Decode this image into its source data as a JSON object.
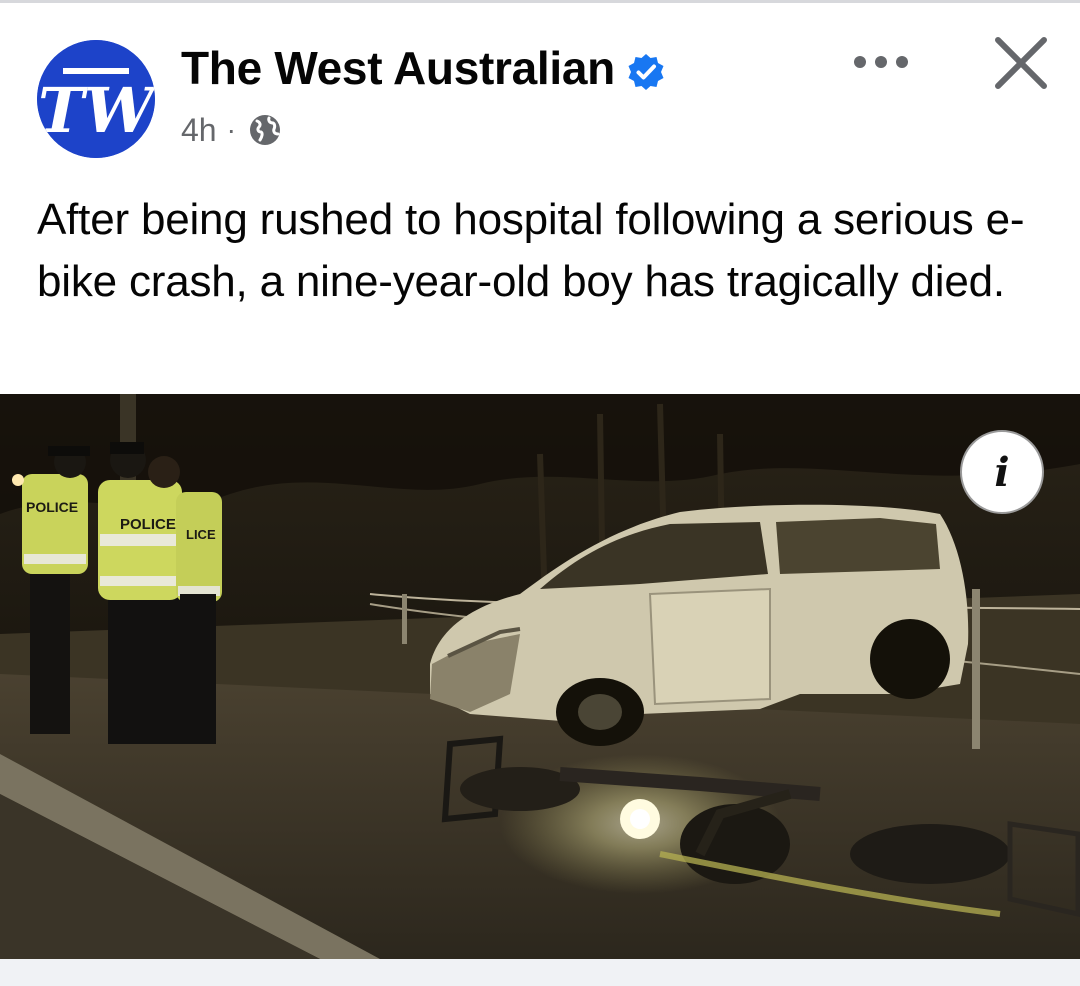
{
  "post": {
    "page_name": "The West Australian",
    "avatar_monogram": "TW",
    "timestamp": "4h",
    "separator": "·",
    "audience_icon": "globe-icon",
    "verified_icon": "verified-badge-icon",
    "caption": "After being rushed to hospital following a serious e-bike crash, a nine-year-old boy has tragically died.",
    "menu_icon": "more-options-icon",
    "close_icon": "close-icon"
  },
  "photo": {
    "vest_labels": [
      "POLICE",
      "POLICE",
      "LICE"
    ],
    "info_label": "i"
  },
  "colors": {
    "brand_blue": "#1d43c9",
    "verified_blue": "#1877f2",
    "secondary_text": "#65676b"
  }
}
